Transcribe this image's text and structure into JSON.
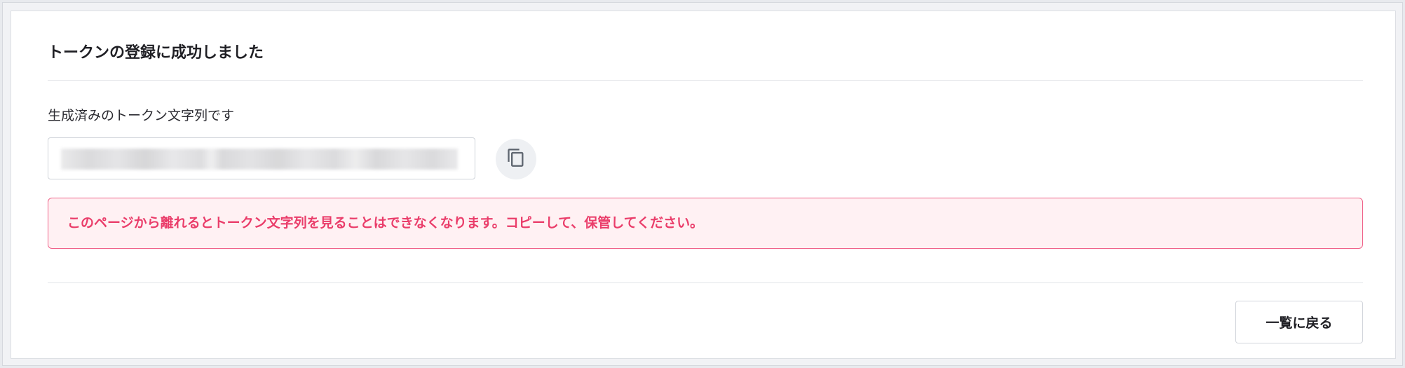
{
  "card": {
    "title": "トークンの登録に成功しました"
  },
  "token": {
    "label": "生成済みのトークン文字列です",
    "value_state": "blurred / redacted"
  },
  "copy_button": {
    "icon": "copy-icon",
    "tooltip": ""
  },
  "alert": {
    "message": "このページから離れるとトークン文字列を見ることはできなくなります。コピーして、保管してください。",
    "border_color": "#f0638a",
    "background_color": "#fff1f3",
    "text_color": "#ea3d6a"
  },
  "footer": {
    "back_label": "一覧に戻る"
  }
}
